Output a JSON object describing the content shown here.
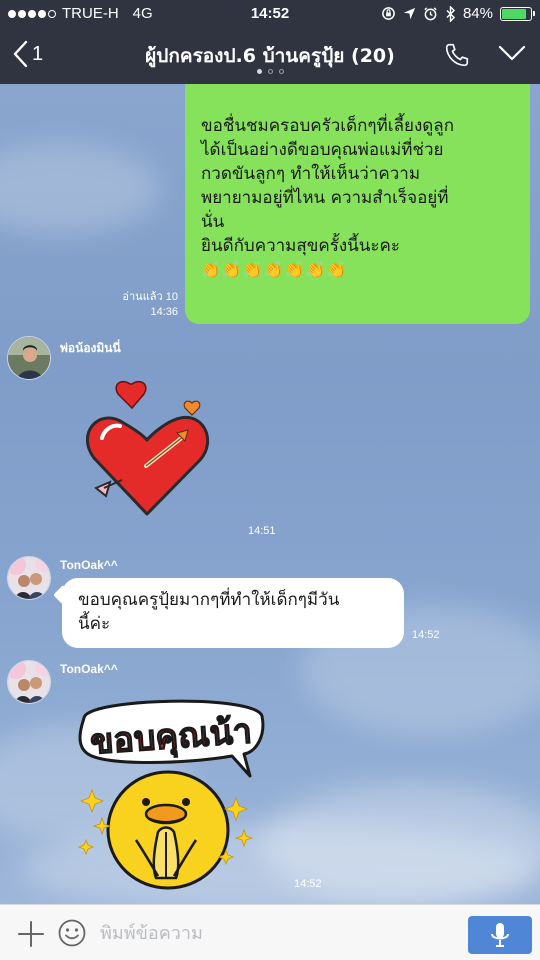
{
  "status_bar": {
    "carrier": "TRUE-H",
    "network": "4G",
    "time": "14:52",
    "battery": "84%",
    "battery_level": 0.84
  },
  "header": {
    "back_count": "1",
    "title": "ผู้ปกครองป.6 บ้านครูปุ้ย (20)"
  },
  "messages": {
    "m1": {
      "lines": [
        "ขอชื่นชมครอบครัวเด็กๆที่เลี้ยงดูลูก",
        "ได้เป็นอย่างดีขอบคุณพ่อแม่ที่ช่วย",
        "กวดขันลูกๆ ทำให้เห็นว่าความ",
        "พยายามอยู่ที่ไหน ความสำเร็จอยู่ที่",
        "นั่น",
        "ยินดีกับความสุขครั้งนี้นะคะ"
      ],
      "emoji": "👏👏👏👏👏👏👏",
      "read_status": "อ่านแล้ว 10",
      "time": "14:36"
    },
    "m2": {
      "sender": "พ่อน้องมินนี่",
      "time": "14:51"
    },
    "m3": {
      "sender": "TonOak^^",
      "lines": [
        "ขอบคุณครูปุ้ยมากๆที่ทำให้เด็กๆมีวัน",
        "นี้ค่ะ"
      ],
      "time": "14:52"
    },
    "m4": {
      "sender": "TonOak^^",
      "sticker_text": "ขอบคุณน้า",
      "time": "14:52"
    }
  },
  "input": {
    "placeholder": "พิมพ์ข้อความ"
  },
  "colors": {
    "header": "#2f3440",
    "bubble_me": "#86e15b",
    "bubble_other": "#ffffff",
    "mic_button": "#4f86d6"
  }
}
